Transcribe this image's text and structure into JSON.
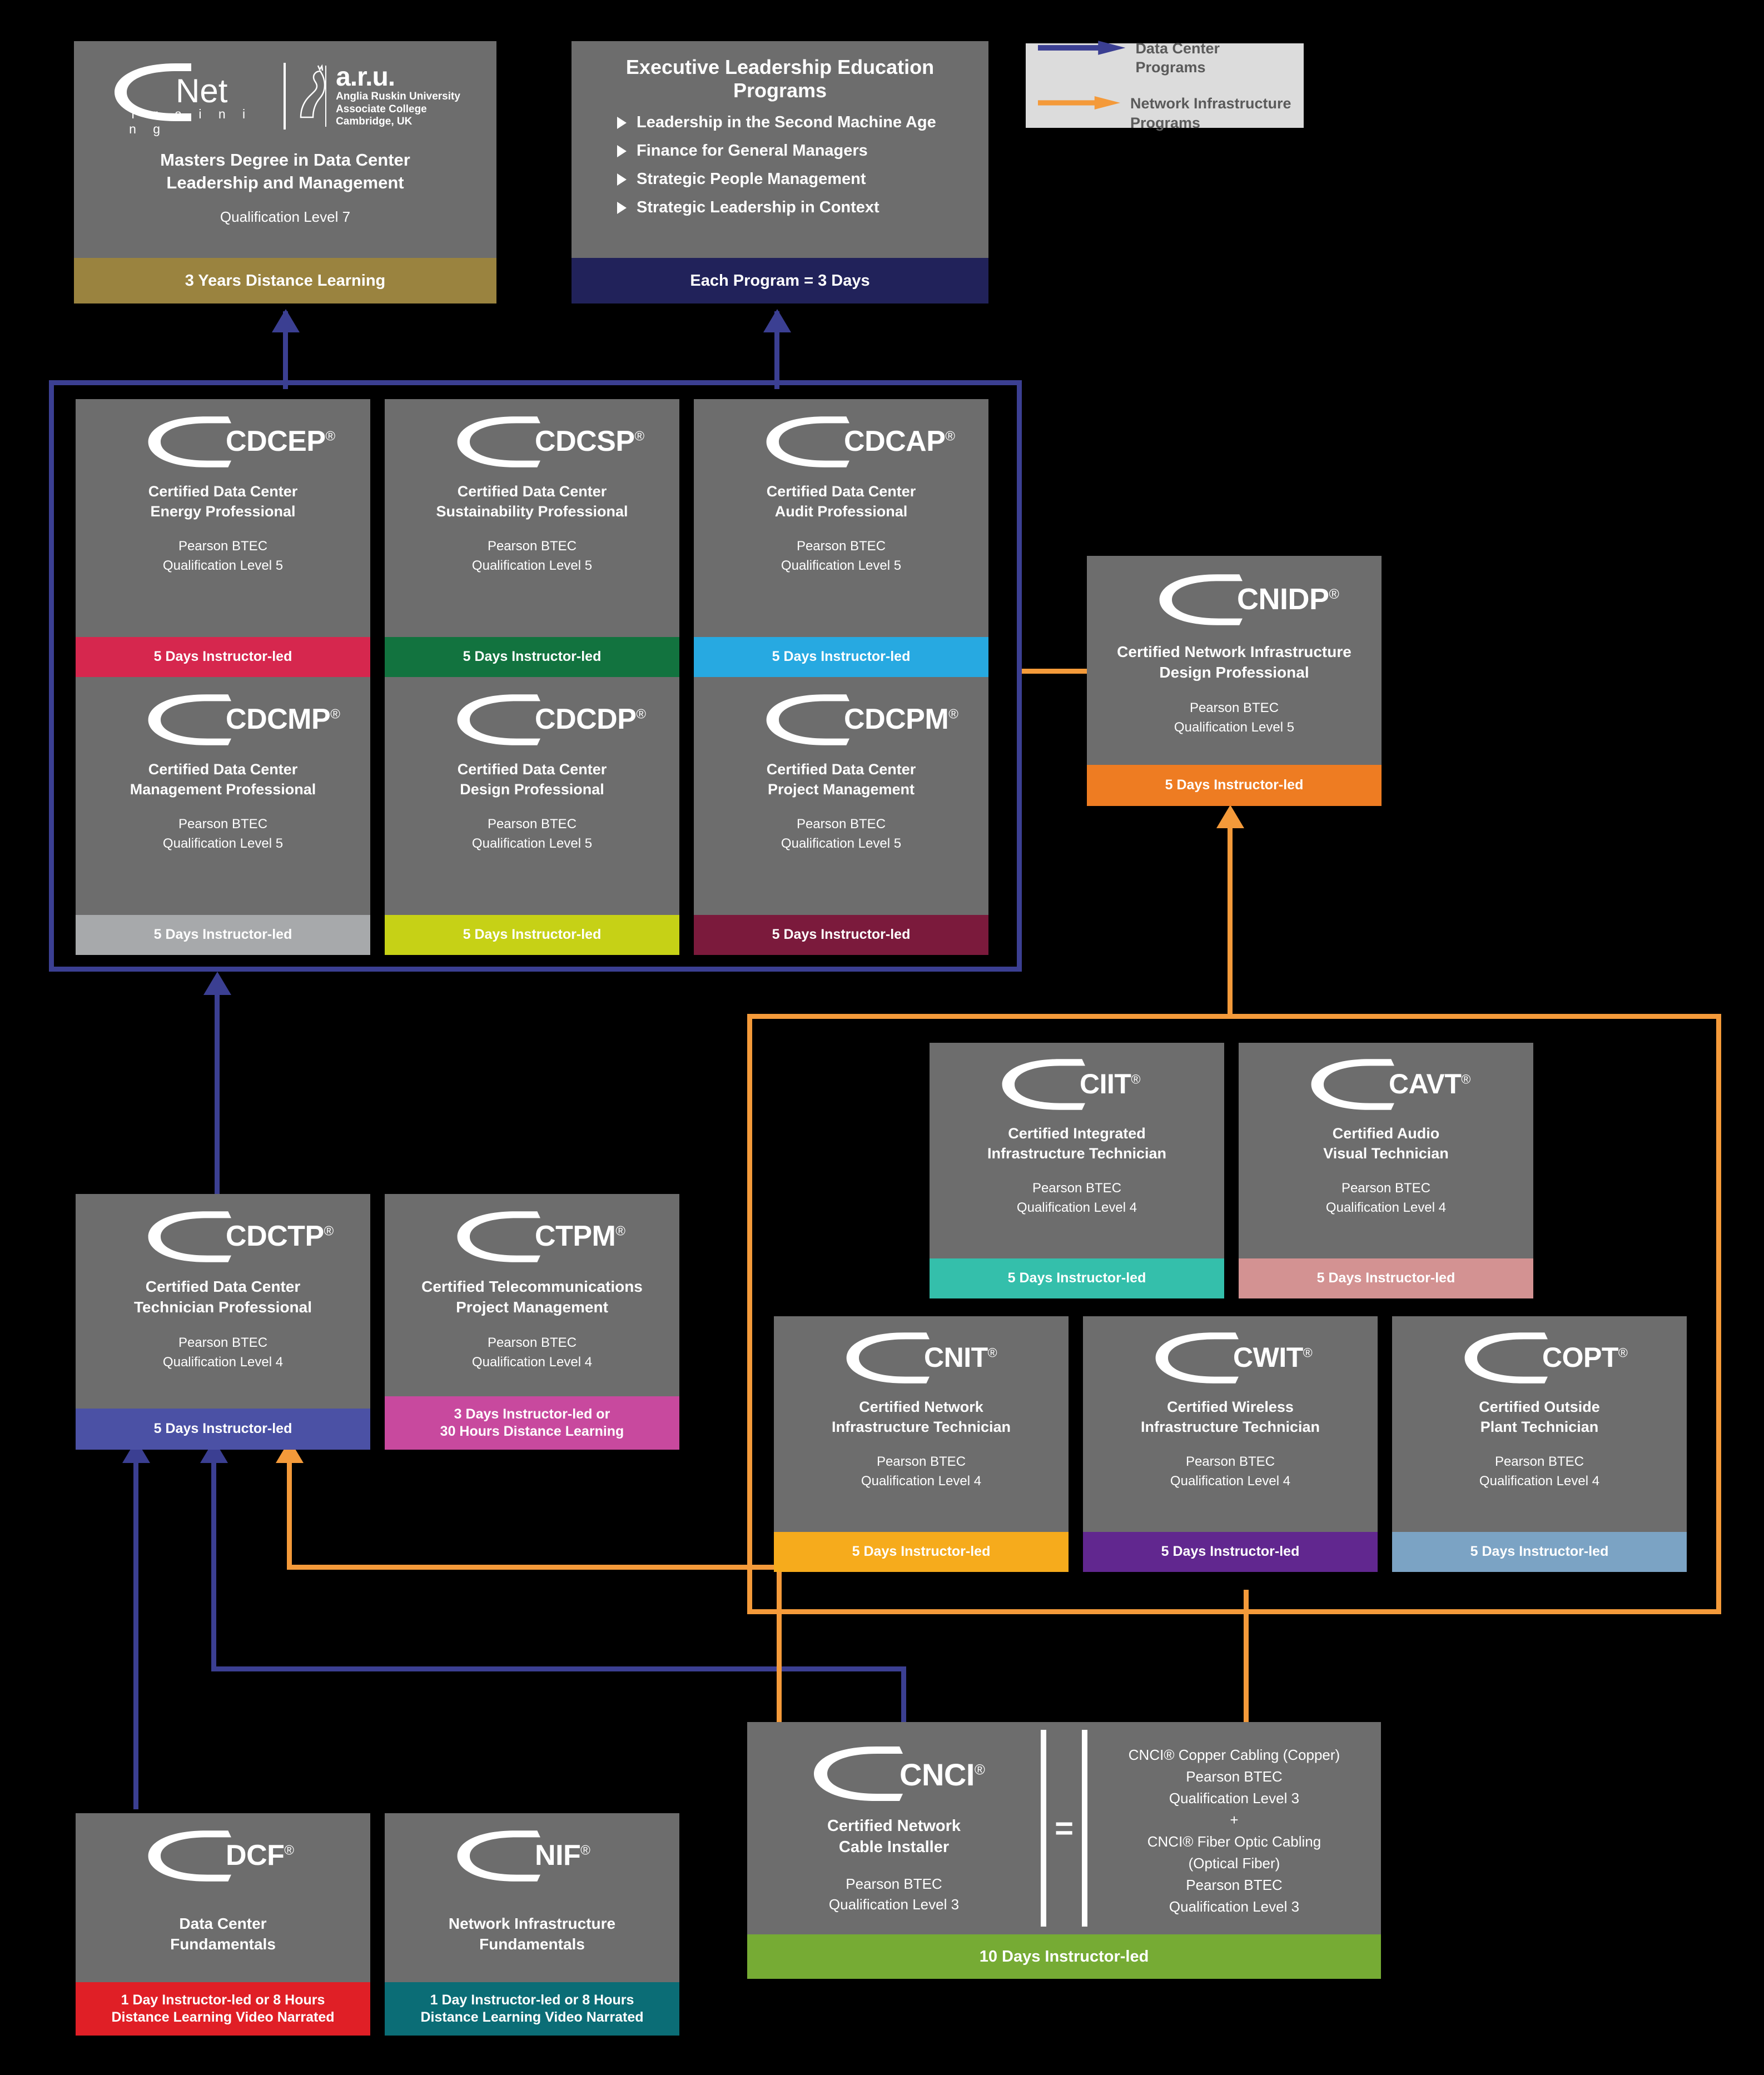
{
  "legend": {
    "items": [
      {
        "label": "Data Center Programs",
        "color": "#3b3f92"
      },
      {
        "label": "Network Infrastructure Programs",
        "color": "#f49a3a"
      }
    ]
  },
  "masters": {
    "brand_primary": "CNet",
    "brand_primary_sub": "T r a i n i n g",
    "brand_partner_abbr": "a.r.u.",
    "brand_partner_line1": "Anglia Ruskin University",
    "brand_partner_line2": "Associate College",
    "brand_partner_line3": "Cambridge, UK",
    "title_line1": "Masters Degree in Data Center",
    "title_line2": "Leadership and Management",
    "qualification": "Qualification Level 7",
    "footer": "3 Years Distance Learning",
    "footer_color": "#9a833f"
  },
  "executive": {
    "title": "Executive Leadership Education Programs",
    "programs": [
      "Leadership in the Second Machine Age",
      "Finance for General Managers",
      "Strategic People Management",
      "Strategic Leadership in Context"
    ],
    "footer": "Each Program = 3 Days",
    "footer_color": "#21225a"
  },
  "data_center_group": {
    "cards": [
      {
        "code": "CDCEP",
        "reg": "®",
        "name_line1": "Certified Data Center",
        "name_line2": "Energy Professional",
        "qual_line1": "Pearson BTEC",
        "qual_line2": "Qualification Level 5",
        "footer": "5 Days Instructor-led",
        "footer_color": "#d6274e"
      },
      {
        "code": "CDCSP",
        "reg": "®",
        "name_line1": "Certified Data Center",
        "name_line2": "Sustainability Professional",
        "qual_line1": "Pearson BTEC",
        "qual_line2": "Qualification Level 5",
        "footer": "5 Days Instructor-led",
        "footer_color": "#12733f"
      },
      {
        "code": "CDCAP",
        "reg": "®",
        "name_line1": "Certified Data Center",
        "name_line2": "Audit Professional",
        "qual_line1": "Pearson BTEC",
        "qual_line2": "Qualification Level 5",
        "footer": "5 Days Instructor-led",
        "footer_color": "#27a9e1"
      },
      {
        "code": "CDCMP",
        "reg": "®",
        "name_line1": "Certified Data Center",
        "name_line2": "Management Professional",
        "qual_line1": "Pearson BTEC",
        "qual_line2": "Qualification Level 5",
        "footer": "5 Days Instructor-led",
        "footer_color": "#a7a9ab"
      },
      {
        "code": "CDCDP",
        "reg": "®",
        "name_line1": "Certified Data Center",
        "name_line2": "Design Professional",
        "qual_line1": "Pearson BTEC",
        "qual_line2": "Qualification Level 5",
        "footer": "5 Days Instructor-led",
        "footer_color": "#c6d116"
      },
      {
        "code": "CDCPM",
        "reg": "®",
        "name_line1": "Certified Data Center",
        "name_line2": "Project Management",
        "qual_line1": "Pearson BTEC",
        "qual_line2": "Qualification Level 5",
        "footer": "5 Days Instructor-led",
        "footer_color": "#7b1a3c"
      }
    ]
  },
  "cnidp": {
    "code": "CNIDP",
    "reg": "®",
    "name_line1": "Certified Network Infrastructure",
    "name_line2": "Design Professional",
    "qual_line1": "Pearson BTEC",
    "qual_line2": "Qualification Level 5",
    "footer": "5 Days Instructor-led",
    "footer_color": "#ee7c22"
  },
  "network_group": {
    "cards": [
      {
        "code": "CIIT",
        "reg": "®",
        "name_line1": "Certified Integrated",
        "name_line2": "Infrastructure Technician",
        "qual_line1": "Pearson BTEC",
        "qual_line2": "Qualification Level 4",
        "footer": "5 Days Instructor-led",
        "footer_color": "#34bfab"
      },
      {
        "code": "CAVT",
        "reg": "®",
        "name_line1": "Certified Audio",
        "name_line2": "Visual Technician",
        "qual_line1": "Pearson BTEC",
        "qual_line2": "Qualification Level 4",
        "footer": "5 Days Instructor-led",
        "footer_color": "#d39292"
      },
      {
        "code": "CNIT",
        "reg": "®",
        "name_line1": "Certified Network",
        "name_line2": "Infrastructure Technician",
        "qual_line1": "Pearson BTEC",
        "qual_line2": "Qualification Level 4",
        "footer": "5 Days Instructor-led",
        "footer_color": "#f6ab1c"
      },
      {
        "code": "CWIT",
        "reg": "®",
        "name_line1": "Certified Wireless",
        "name_line2": "Infrastructure Technician",
        "qual_line1": "Pearson BTEC",
        "qual_line2": "Qualification Level 4",
        "footer": "5 Days Instructor-led",
        "footer_color": "#61278f"
      },
      {
        "code": "COPT",
        "reg": "®",
        "name_line1": "Certified Outside",
        "name_line2": "Plant Technician",
        "qual_line1": "Pearson BTEC",
        "qual_line2": "Qualification Level 4",
        "footer": "5 Days Instructor-led",
        "footer_color": "#7ba3c4"
      }
    ]
  },
  "cdctp": {
    "code": "CDCTP",
    "reg": "®",
    "name_line1": "Certified Data Center",
    "name_line2": "Technician Professional",
    "qual_line1": "Pearson BTEC",
    "qual_line2": "Qualification Level 4",
    "footer": "5 Days Instructor-led",
    "footer_color": "#4b51a5"
  },
  "ctpm": {
    "code": "CTPM",
    "reg": "®",
    "name_line1": "Certified Telecommunications",
    "name_line2": "Project Management",
    "qual_line1": "Pearson BTEC",
    "qual_line2": "Qualification Level 4",
    "footer_line1": "3 Days Instructor-led or",
    "footer_line2": "30 Hours Distance Learning",
    "footer_color": "#c8499e"
  },
  "dcf": {
    "code": "DCF",
    "reg": "®",
    "name_line1": "Data Center",
    "name_line2": "Fundamentals",
    "footer_line1": "1 Day Instructor-led or 8 Hours",
    "footer_line2": "Distance Learning Video Narrated",
    "footer_color": "#e01f26"
  },
  "nif": {
    "code": "NIF",
    "reg": "®",
    "name_line1": "Network Infrastructure",
    "name_line2": "Fundamentals",
    "footer_line1": "1 Day Instructor-led or 8 Hours",
    "footer_line2": "Distance Learning Video Narrated",
    "footer_color": "#0b6d76"
  },
  "cnci": {
    "code": "CNCI",
    "reg": "®",
    "name_line1": "Certified Network",
    "name_line2": "Cable Installer",
    "qual_line1": "Pearson BTEC",
    "qual_line2": "Qualification Level 3",
    "equals": "=",
    "right_lines": [
      "CNCI® Copper Cabling (Copper)",
      "Pearson BTEC",
      "Qualification Level 3",
      "+",
      "CNCI® Fiber Optic Cabling",
      "(Optical Fiber)",
      "Pearson BTEC",
      "Qualification Level 3"
    ],
    "footer": "10 Days Instructor-led",
    "footer_color": "#76ab34"
  }
}
